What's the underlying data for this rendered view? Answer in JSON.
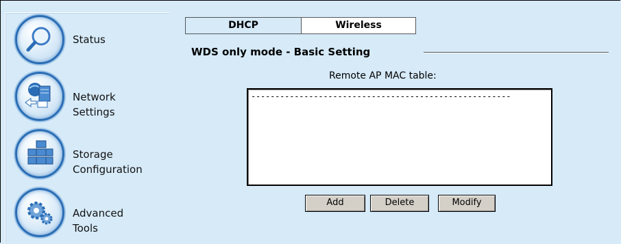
{
  "sidebar": {
    "items": [
      {
        "label": "Status",
        "icon": "magnifier-icon"
      },
      {
        "label": "Network\nSettings",
        "icon": "network-icon"
      },
      {
        "label": "Storage\nConfiguration",
        "icon": "storage-icon"
      },
      {
        "label": "Advanced\nTools",
        "icon": "gears-icon"
      }
    ]
  },
  "tabs": [
    {
      "label": "DHCP"
    },
    {
      "label": "Wireless"
    }
  ],
  "section": {
    "title": "WDS only mode - Basic Setting"
  },
  "mac_table": {
    "label": "Remote AP MAC table:",
    "selected_entry": "------------------------------------------------------"
  },
  "buttons": {
    "add": "Add",
    "delete": "Delete",
    "modify": "Modify"
  },
  "colors": {
    "background": "#d6eaf8",
    "icon_ring": "#2a6db5",
    "button_face": "#d4d0c8"
  }
}
